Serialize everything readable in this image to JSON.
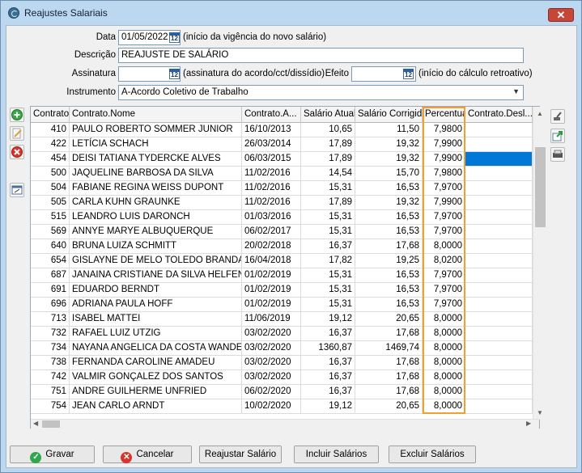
{
  "window": {
    "title": "Reajustes Salariais",
    "close_label": "✕"
  },
  "form": {
    "data_label": "Data",
    "data_value": "01/05/2022",
    "data_hint": "(início da vigência do novo salário)",
    "descricao_label": "Descrição",
    "descricao_value": "REAJUSTE DE SALÁRIO",
    "assinatura_label": "Assinatura",
    "assinatura_value": "",
    "assinatura_hint": "(assinatura do acordo/cct/dissídio)",
    "efeito_label": "Efeito",
    "efeito_value": "",
    "efeito_hint": "(início do cálculo retroativo)",
    "instrumento_label": "Instrumento",
    "instrumento_value": "A-Acordo Coletivo de Trabalho",
    "calendar_glyph": "12"
  },
  "grid": {
    "columns": [
      "Contrato",
      "Contrato.Nome",
      "Contrato.A...",
      "Salário Atual",
      "Salário Corrigido",
      "Percentual",
      "Contrato.Desl..."
    ],
    "rows": [
      {
        "contrato": "410",
        "nome": "PAULO ROBERTO SOMMER JUNIOR",
        "admissao": "16/10/2013",
        "atual": "10,65",
        "corrigido": "11,50",
        "percentual": "7,9800",
        "desl": ""
      },
      {
        "contrato": "422",
        "nome": "LETÍCIA SCHACH",
        "admissao": "26/03/2014",
        "atual": "17,89",
        "corrigido": "19,32",
        "percentual": "7,9900",
        "desl": ""
      },
      {
        "contrato": "454",
        "nome": "DEISI TATIANA TYDERCKE ALVES",
        "admissao": "06/03/2015",
        "atual": "17,89",
        "corrigido": "19,32",
        "percentual": "7,9900",
        "desl": ""
      },
      {
        "contrato": "500",
        "nome": "JAQUELINE BARBOSA DA SILVA",
        "admissao": "11/02/2016",
        "atual": "14,54",
        "corrigido": "15,70",
        "percentual": "7,9800",
        "desl": ""
      },
      {
        "contrato": "504",
        "nome": "FABIANE REGINA WEISS DUPONT",
        "admissao": "11/02/2016",
        "atual": "15,31",
        "corrigido": "16,53",
        "percentual": "7,9700",
        "desl": ""
      },
      {
        "contrato": "505",
        "nome": "CARLA KUHN GRAUNKE",
        "admissao": "11/02/2016",
        "atual": "17,89",
        "corrigido": "19,32",
        "percentual": "7,9900",
        "desl": ""
      },
      {
        "contrato": "515",
        "nome": "LEANDRO LUIS DARONCH",
        "admissao": "01/03/2016",
        "atual": "15,31",
        "corrigido": "16,53",
        "percentual": "7,9700",
        "desl": ""
      },
      {
        "contrato": "569",
        "nome": "ANNYE MARYE ALBUQUERQUE",
        "admissao": "06/02/2017",
        "atual": "15,31",
        "corrigido": "16,53",
        "percentual": "7,9700",
        "desl": ""
      },
      {
        "contrato": "640",
        "nome": "BRUNA LUIZA SCHMITT",
        "admissao": "20/02/2018",
        "atual": "16,37",
        "corrigido": "17,68",
        "percentual": "8,0000",
        "desl": ""
      },
      {
        "contrato": "654",
        "nome": "GISLAYNE DE MELO TOLEDO BRANDAO",
        "admissao": "16/04/2018",
        "atual": "17,82",
        "corrigido": "19,25",
        "percentual": "8,0200",
        "desl": ""
      },
      {
        "contrato": "687",
        "nome": "JANAINA CRISTIANE DA SILVA HELFENSTEIN",
        "admissao": "01/02/2019",
        "atual": "15,31",
        "corrigido": "16,53",
        "percentual": "7,9700",
        "desl": ""
      },
      {
        "contrato": "691",
        "nome": "EDUARDO BERNDT",
        "admissao": "01/02/2019",
        "atual": "15,31",
        "corrigido": "16,53",
        "percentual": "7,9700",
        "desl": ""
      },
      {
        "contrato": "696",
        "nome": "ADRIANA PAULA HOFF",
        "admissao": "01/02/2019",
        "atual": "15,31",
        "corrigido": "16,53",
        "percentual": "7,9700",
        "desl": ""
      },
      {
        "contrato": "713",
        "nome": "ISABEL MATTEI",
        "admissao": "11/06/2019",
        "atual": "19,12",
        "corrigido": "20,65",
        "percentual": "8,0000",
        "desl": ""
      },
      {
        "contrato": "732",
        "nome": "RAFAEL LUIZ UTZIG",
        "admissao": "03/02/2020",
        "atual": "16,37",
        "corrigido": "17,68",
        "percentual": "8,0000",
        "desl": ""
      },
      {
        "contrato": "734",
        "nome": "NAYANA ANGELICA DA COSTA WANDERLEY",
        "admissao": "03/02/2020",
        "atual": "1360,87",
        "corrigido": "1469,74",
        "percentual": "8,0000",
        "desl": ""
      },
      {
        "contrato": "738",
        "nome": "FERNANDA CAROLINE AMADEU",
        "admissao": "03/02/2020",
        "atual": "16,37",
        "corrigido": "17,68",
        "percentual": "8,0000",
        "desl": ""
      },
      {
        "contrato": "742",
        "nome": "VALMIR GONÇALEZ DOS SANTOS",
        "admissao": "03/02/2020",
        "atual": "16,37",
        "corrigido": "17,68",
        "percentual": "8,0000",
        "desl": ""
      },
      {
        "contrato": "751",
        "nome": "ANDRE GUILHERME UNFRIED",
        "admissao": "06/02/2020",
        "atual": "16,37",
        "corrigido": "17,68",
        "percentual": "8,0000",
        "desl": ""
      },
      {
        "contrato": "754",
        "nome": "JEAN CARLO ARNDT",
        "admissao": "10/02/2020",
        "atual": "19,12",
        "corrigido": "20,65",
        "percentual": "8,0000",
        "desl": ""
      }
    ],
    "selected_row": 2,
    "selected_column": 6
  },
  "buttons": {
    "gravar": "Gravar",
    "cancelar": "Cancelar",
    "reajustar": "Reajustar Salário",
    "incluir": "Incluir Salários",
    "excluir": "Excluir Salários"
  },
  "colors": {
    "accent_selection": "#0078d7",
    "highlight_box": "#f0a030",
    "window_frame": "#bcd7f0"
  }
}
